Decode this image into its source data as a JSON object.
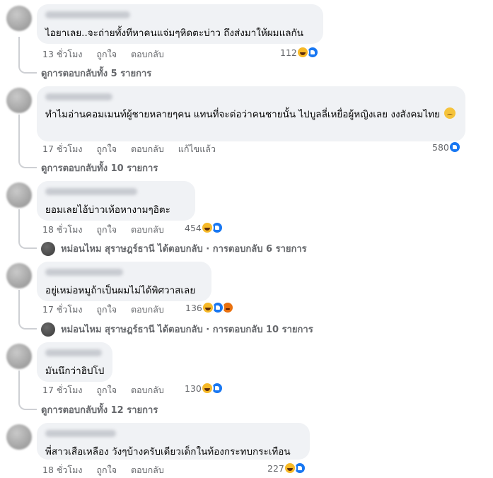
{
  "comments": [
    {
      "text": "ไอยาเลย..จะถ่ายทั้งทีหาคนแจ่มๆหิดตะบ่าว ถึงส่งมาให้ผมแลกัน",
      "time": "13 ชั่วโมง",
      "like": "ถูกใจ",
      "reply": "ตอบกลับ",
      "reaction_count": "112",
      "reactions": [
        "haha",
        "like"
      ],
      "replies_label": "ดูการตอบกลับทั้ง 5 รายการ"
    },
    {
      "text": "ทำไมอ่านคอมเมนท์ผู้ชายหลายๆคน แทนที่จะต่อว่าคนชายนั้น ไปบูลลี่เหยื่อผู้หญิงเลย งงสังคมไทย",
      "time": "17 ชั่วโมง",
      "like": "ถูกใจ",
      "reply": "ตอบกลับ",
      "edited": "แก้ไขแล้ว",
      "reaction_count": "580",
      "reactions": [
        "like"
      ],
      "replies_label": "ดูการตอบกลับทั้ง 10 รายการ"
    },
    {
      "text": "ยอมเลยไอ้บ่าวเห้อหางามๆอิตะ",
      "time": "18 ชั่วโมง",
      "like": "ถูกใจ",
      "reply": "ตอบกลับ",
      "reaction_count": "454",
      "reactions": [
        "haha",
        "like"
      ],
      "replies_label": "หม่อนไหม สุราษฎร์ธานี ได้ตอบกลับ · การตอบกลับ 6 รายการ"
    },
    {
      "text": "อยู่เหม่อหมูถ้าเป็นผมไม่ได้พิศวาสเลย",
      "time": "17 ชั่วโมง",
      "like": "ถูกใจ",
      "reply": "ตอบกลับ",
      "reaction_count": "136",
      "reactions": [
        "haha",
        "like",
        "angry"
      ],
      "replies_label": "หม่อนไหม สุราษฎร์ธานี ได้ตอบกลับ · การตอบกลับ 10 รายการ"
    },
    {
      "text": "มันนึกว่าฮิปโป",
      "time": "17 ชั่วโมง",
      "like": "ถูกใจ",
      "reply": "ตอบกลับ",
      "reaction_count": "130",
      "reactions": [
        "haha",
        "like"
      ],
      "replies_label": "ดูการตอบกลับทั้ง 12 รายการ"
    },
    {
      "text": "พี่สาวเสือเหลือง วังๆบ้างครับเดียวเด็กในท้องกระทบกระเทือน",
      "time": "18 ชั่วโมง",
      "like": "ถูกใจ",
      "reply": "ตอบกลับ",
      "reaction_count": "227",
      "reactions": [
        "haha",
        "like"
      ]
    }
  ],
  "colors": {
    "bubble": "#f0f2f5",
    "meta": "#65676b",
    "like_blue": "#1877f2",
    "haha_yellow": "#f7b928",
    "angry_orange": "#e9710f"
  }
}
